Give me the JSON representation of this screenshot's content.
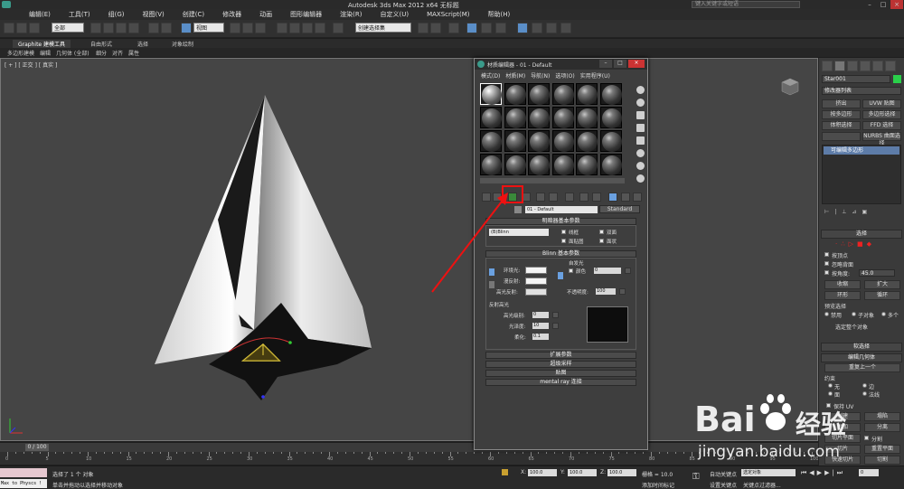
{
  "titlebar": {
    "title": "Autodesk 3ds Max  2012 x64        无标题",
    "search_placeholder": "键入关键字或短语"
  },
  "menubar": {
    "items": [
      "编辑(E)",
      "工具(T)",
      "组(G)",
      "视图(V)",
      "创建(C)",
      "修改器",
      "动画",
      "图形编辑器",
      "渲染(R)",
      "自定义(U)",
      "MAXScript(M)",
      "帮助(H)"
    ]
  },
  "toolbar": {
    "selection_filter": "全部",
    "ref_coord": "视图",
    "named_selection": "创建选择集"
  },
  "ribbon": {
    "tabs": [
      "Graphite 建模工具",
      "自由形式",
      "选择",
      "对象绘制"
    ],
    "subtabs": [
      "多边形建模",
      "编辑",
      "几何体 (全部)",
      "细分",
      "对齐",
      "属性"
    ]
  },
  "viewport": {
    "label": "[ + ] [ 正交 ] [ 真实 ]"
  },
  "timeline": {
    "frame": "0 / 100",
    "ticks": [
      "0",
      "5",
      "10",
      "15",
      "20",
      "25",
      "30",
      "35",
      "40",
      "45",
      "50",
      "55",
      "60",
      "65",
      "70",
      "75",
      "80",
      "85",
      "90",
      "95",
      "100"
    ]
  },
  "statusbar": {
    "maxscript": "Max to Physcs !",
    "selected": "选择了 1 个 对象",
    "prompt": "单击并拖动以选择并移动对象",
    "x_label": "X:",
    "x_val": "100.0",
    "y_label": "Y:",
    "y_val": "100.0",
    "z_label": "Z:",
    "z_val": "100.0",
    "grid": "栅格 = 10.0",
    "auto_key": "自动关键点",
    "set_key": "设置关键点",
    "add_time_tag": "添加时间标记",
    "key_filter": "关键点过滤器...",
    "selected_obj": "选定对象"
  },
  "cmdpanel": {
    "object_name": "Star001",
    "modifier_list": "修改器列表",
    "buttons": [
      "挤出",
      "UVW 贴图",
      "按多边形",
      "多边形选择",
      "体积选择",
      "FFD 选择",
      "",
      "NURBS 曲面选择"
    ],
    "stack_item": "可编辑多边形",
    "select_rollout": "选择",
    "by_vertex": "按顶点",
    "ignore_backface": "忽略背面",
    "by_angle": "按角度:",
    "angle_val": "45.0",
    "shrink": "收缩",
    "grow": "扩大",
    "ring": "环形",
    "loop": "循环",
    "preview_select": "预览选择",
    "disable": "禁用",
    "sub_object": "子对象",
    "multi": "多个",
    "select_whole": "选定整个对象",
    "soft_select": "软选择",
    "edit_geometry": "编辑几何体",
    "repeat_last": "重复上一个",
    "constraint": "约束",
    "none": "无",
    "edge": "边",
    "face": "面",
    "normal": "法线",
    "preserve_uv": "保持 UV",
    "create": "创建",
    "collapse": "塌陷",
    "attach": "附加",
    "detach": "分离",
    "slice_plane": "切片平面",
    "split": "分割",
    "slice": "切片",
    "reset_plane": "重置平面",
    "quickslice": "快速切片",
    "cut": "切割"
  },
  "mated": {
    "title": "材质编辑器 - 01 - Default",
    "menu": [
      "模式(D)",
      "材质(M)",
      "导航(N)",
      "选项(O)",
      "实用程序(U)"
    ],
    "material_name": "01 - Default",
    "material_type": "Standard",
    "shader_rollout": "明暗器基本参数",
    "shader": "(B)Blinn",
    "wire": "线框",
    "two_sided": "双面",
    "face_map": "面贴图",
    "faceted": "面状",
    "blinn_rollout": "Blinn 基本参数",
    "self_illum": "自发光",
    "color": "颜色",
    "color_val": "0",
    "ambient": "环境光:",
    "diffuse": "漫反射:",
    "specular": "高光反射:",
    "opacity": "不透明度:",
    "opacity_val": "100",
    "spec_highlights": "反射高光",
    "spec_level": "高光级别:",
    "spec_level_val": "0",
    "glossiness": "光泽度:",
    "glossiness_val": "10",
    "soften": "柔化:",
    "soften_val": "0.1",
    "rollouts": [
      "扩展参数",
      "超级采样",
      "贴图",
      "mental ray 连接"
    ]
  },
  "watermark": {
    "brand": "Bai",
    "brand2": "经验",
    "url": "jingyan.baidu.com"
  }
}
